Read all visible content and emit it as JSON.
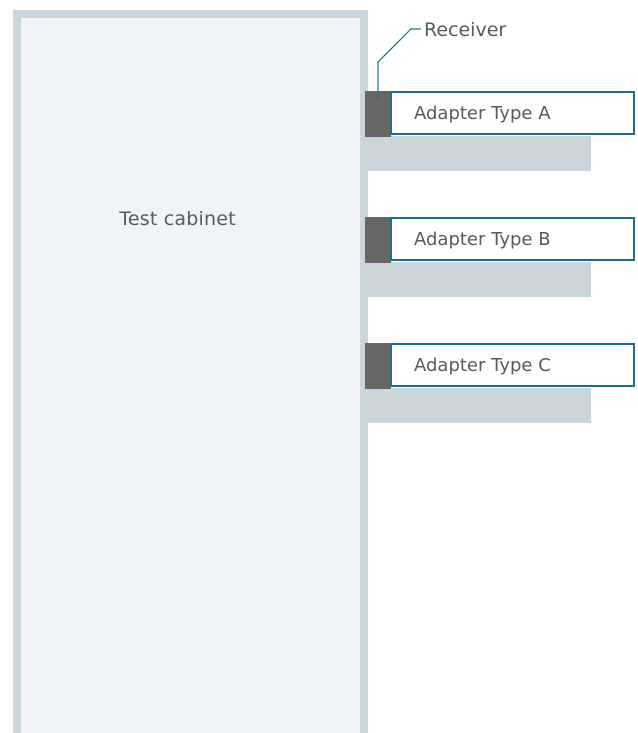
{
  "cabinet": {
    "label": "Test cabinet"
  },
  "receiver": {
    "label": "Receiver"
  },
  "adapters": [
    {
      "label": "Adapter Type A"
    },
    {
      "label": "Adapter Type B"
    },
    {
      "label": "Adapter Type C"
    }
  ],
  "colors": {
    "cabinet_fill": "#f0f4f9",
    "cabinet_border": "#cbd5dc",
    "rail": "#cbd5dc",
    "receiver": "#666666",
    "adapter_border": "#1f6e8c",
    "text": "#555b5f"
  }
}
